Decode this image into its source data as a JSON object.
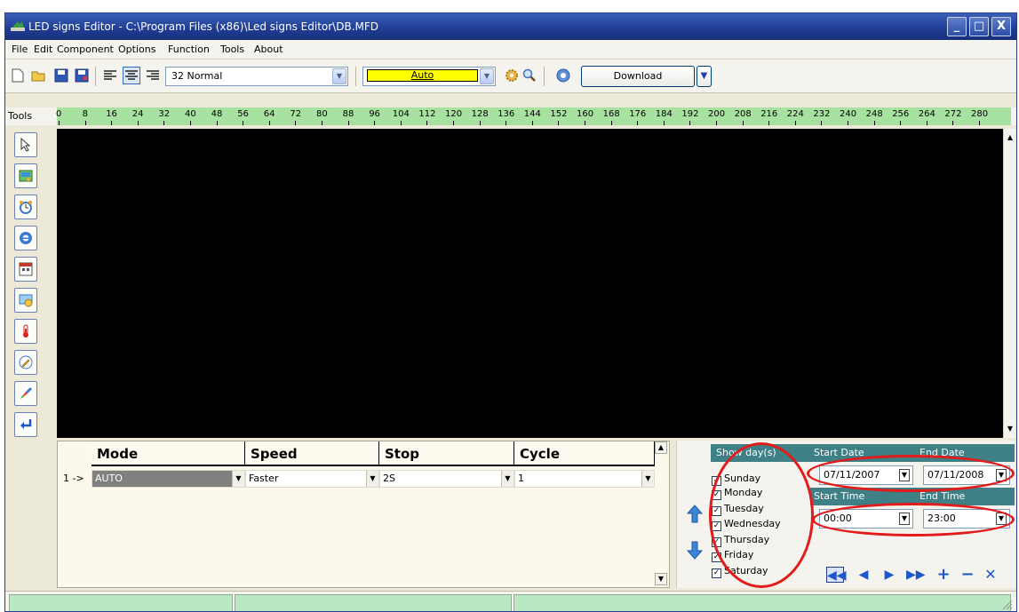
{
  "window": {
    "title": "LED signs Editor - C:\\Program Files (x86)\\Led signs Editor\\DB.MFD",
    "min_label": "_",
    "max_label": "□",
    "close_label": "X"
  },
  "menu": {
    "items": [
      "File",
      "Edit",
      "Component",
      "Options",
      "Function",
      "Tools",
      "About"
    ]
  },
  "toolbar": {
    "font_size_value": "32 Normal",
    "color_value": "Auto",
    "color_swatch": "#ffff00",
    "download_label": "Download"
  },
  "ruler": {
    "tools_label": "Tools",
    "ticks": [
      "0",
      "8",
      "16",
      "24",
      "32",
      "40",
      "48",
      "56",
      "64",
      "72",
      "80",
      "88",
      "96",
      "104",
      "112",
      "120",
      "128",
      "136",
      "144",
      "152",
      "160",
      "168",
      "176",
      "184",
      "192",
      "200",
      "208",
      "216",
      "224",
      "232",
      "240",
      "248",
      "256",
      "264",
      "272",
      "280"
    ],
    "color": "#a8e2a0"
  },
  "toolbox": {
    "icons": [
      "pointer-icon",
      "picture-icon",
      "clock-icon",
      "ie-icon",
      "calendar-icon",
      "timer-icon",
      "thermometer-icon",
      "pencil-icon",
      "paint-icon",
      "enter-icon"
    ]
  },
  "grid": {
    "headers": [
      "Mode",
      "Speed",
      "Stop",
      "Cycle"
    ],
    "row_label": "1 ->",
    "row": {
      "mode": "AUTO",
      "speed": "Faster",
      "stop": "2S",
      "cycle": "1"
    }
  },
  "schedule": {
    "show_days_label": "Show day(s)",
    "start_date_label": "Start Date",
    "end_date_label": "End Date",
    "start_time_label": "Start Time",
    "end_time_label": "End Time",
    "start_date": "07/11/2007",
    "end_date": "07/11/2008",
    "start_time": "00:00",
    "end_time": "23:00",
    "days": [
      "Sunday",
      "Monday",
      "Tuesday",
      "Wednesday",
      "Thursday",
      "Friday",
      "Saturday"
    ],
    "bar_color": "#3f7f86",
    "highlight_color": "#e21b1b"
  }
}
